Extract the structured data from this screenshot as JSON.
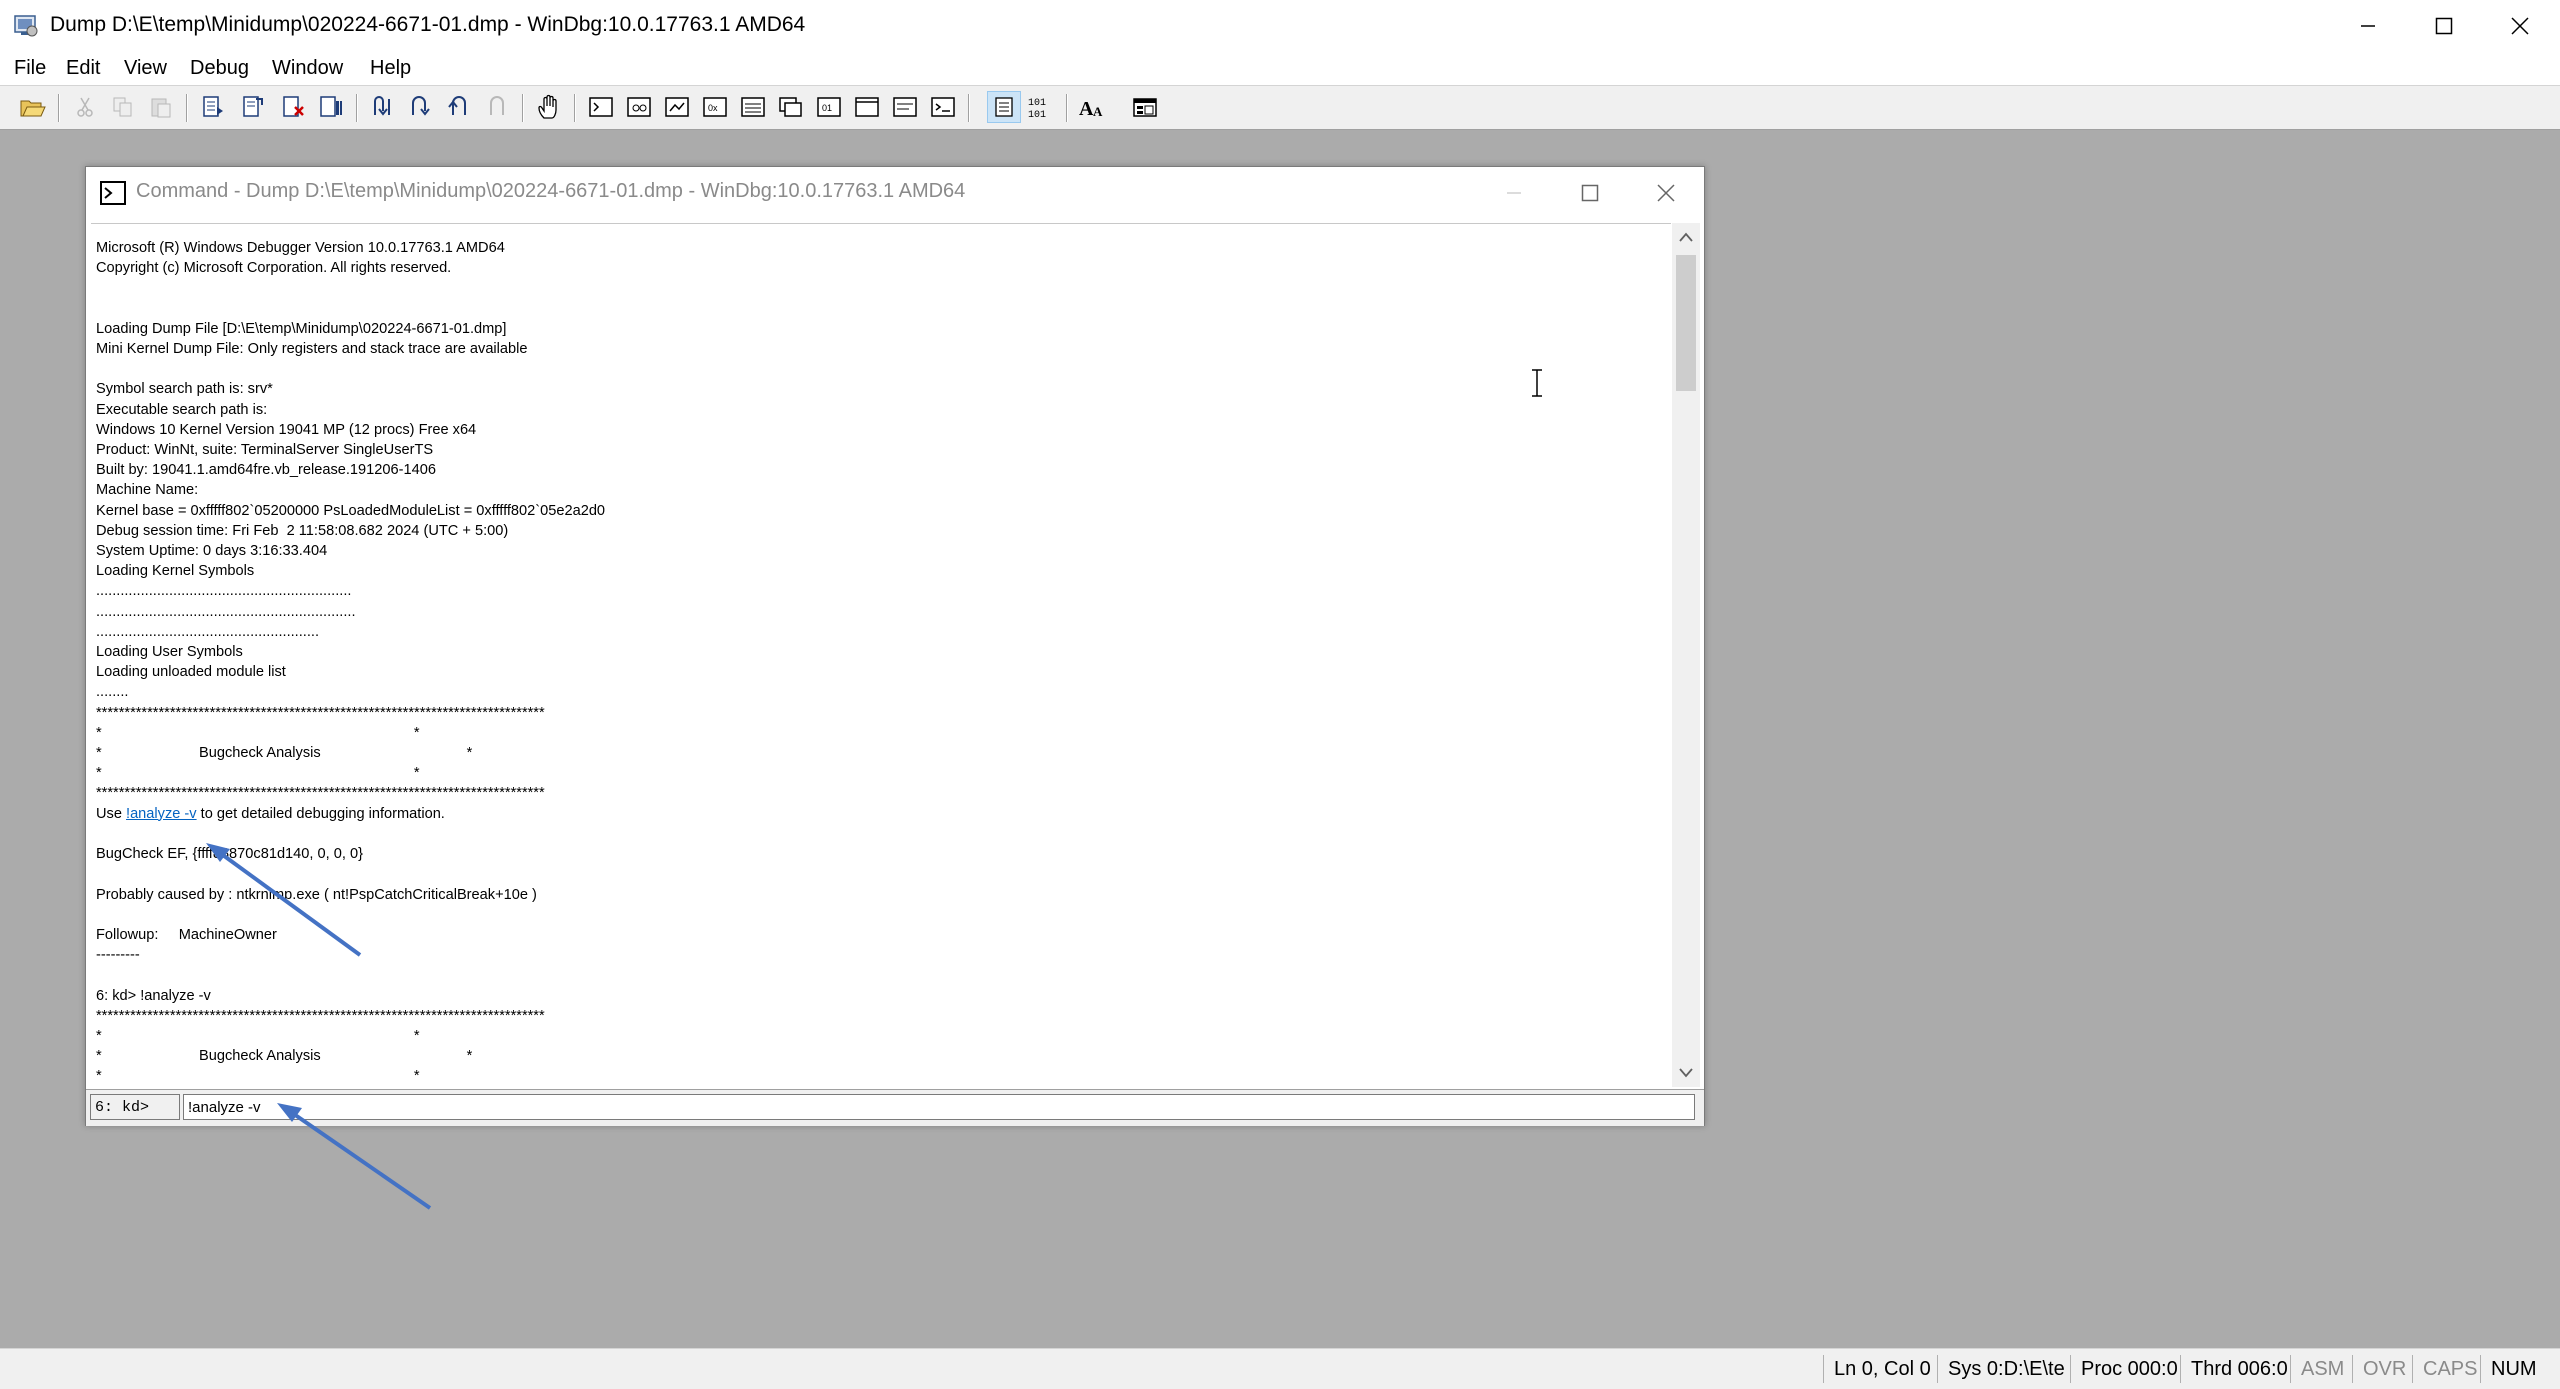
{
  "window": {
    "title": "Dump D:\\E\\temp\\Minidump\\020224-6671-01.dmp - WinDbg:10.0.17763.1 AMD64"
  },
  "menu": [
    "File",
    "Edit",
    "View",
    "Debug",
    "Window",
    "Help"
  ],
  "command_window": {
    "title": "Command - Dump D:\\E\\temp\\Minidump\\020224-6671-01.dmp - WinDbg:10.0.17763.1 AMD64",
    "output": {
      "header": "Microsoft (R) Windows Debugger Version 10.0.17763.1 AMD64\nCopyright (c) Microsoft Corporation. All rights reserved.\n\n\nLoading Dump File [D:\\E\\temp\\Minidump\\020224-6671-01.dmp]\nMini Kernel Dump File: Only registers and stack trace are available\n\nSymbol search path is: srv*\nExecutable search path is: \nWindows 10 Kernel Version 19041 MP (12 procs) Free x64\nProduct: WinNt, suite: TerminalServer SingleUserTS\nBuilt by: 19041.1.amd64fre.vb_release.191206-1406\nMachine Name:\nKernel base = 0xfffff802`05200000 PsLoadedModuleList = 0xfffff802`05e2a2d0\nDebug session time: Fri Feb  2 11:58:08.682 2024 (UTC + 5:00)\nSystem Uptime: 0 days 3:16:33.404\nLoading Kernel Symbols\n...............................................................\n................................................................\n.......................................................\nLoading User Symbols\nLoading unloaded module list\n........\n*******************************************************************************\n*                                                                             *\n*                        Bugcheck Analysis                                    *\n*                                                                             *\n*******************************************************************************\n",
      "use_prefix": "Use ",
      "analyze_link": "!analyze -v",
      "use_suffix": " to get detailed debugging information.",
      "tail": "\n\nBugCheck EF, {ffff88870c81d140, 0, 0, 0}\n\nProbably caused by : ntkrnlmp.exe ( nt!PspCatchCriticalBreak+10e )\n\nFollowup:     MachineOwner\n---------\n\n6: kd> !analyze -v\n*******************************************************************************\n*                                                                             *\n*                        Bugcheck Analysis                                    *\n*                                                                             *"
    },
    "prompt": "6: kd>",
    "input_value": "!analyze -v"
  },
  "statusbar": {
    "ln_col": "Ln 0, Col 0",
    "sys": "Sys 0:D:\\E\\te",
    "proc": "Proc 000:0",
    "thrd": "Thrd 006:0",
    "asm": "ASM",
    "ovr": "OVR",
    "caps": "CAPS",
    "num": "NUM"
  },
  "icons": {
    "app": "windbg-icon",
    "toolbar": [
      "open-icon",
      "cut-icon",
      "copy-icon",
      "paste-icon",
      "go-icon",
      "restart-icon",
      "stop-debugging-icon",
      "break-icon",
      "step-into-icon",
      "step-over-icon",
      "step-out-icon",
      "run-to-cursor-icon",
      "hand-icon",
      "command-window-icon",
      "watch-window-icon",
      "locals-window-icon",
      "registers-window-icon",
      "memory-window-icon",
      "call-stack-icon",
      "disassembly-icon",
      "scratch-pad-icon",
      "processes-threads-icon",
      "source-mode-icon",
      "hex-mode-icon",
      "font-icon",
      "options-icon"
    ]
  },
  "colors": {
    "link": "#0563c1",
    "annotation_arrow": "#4472c4"
  }
}
